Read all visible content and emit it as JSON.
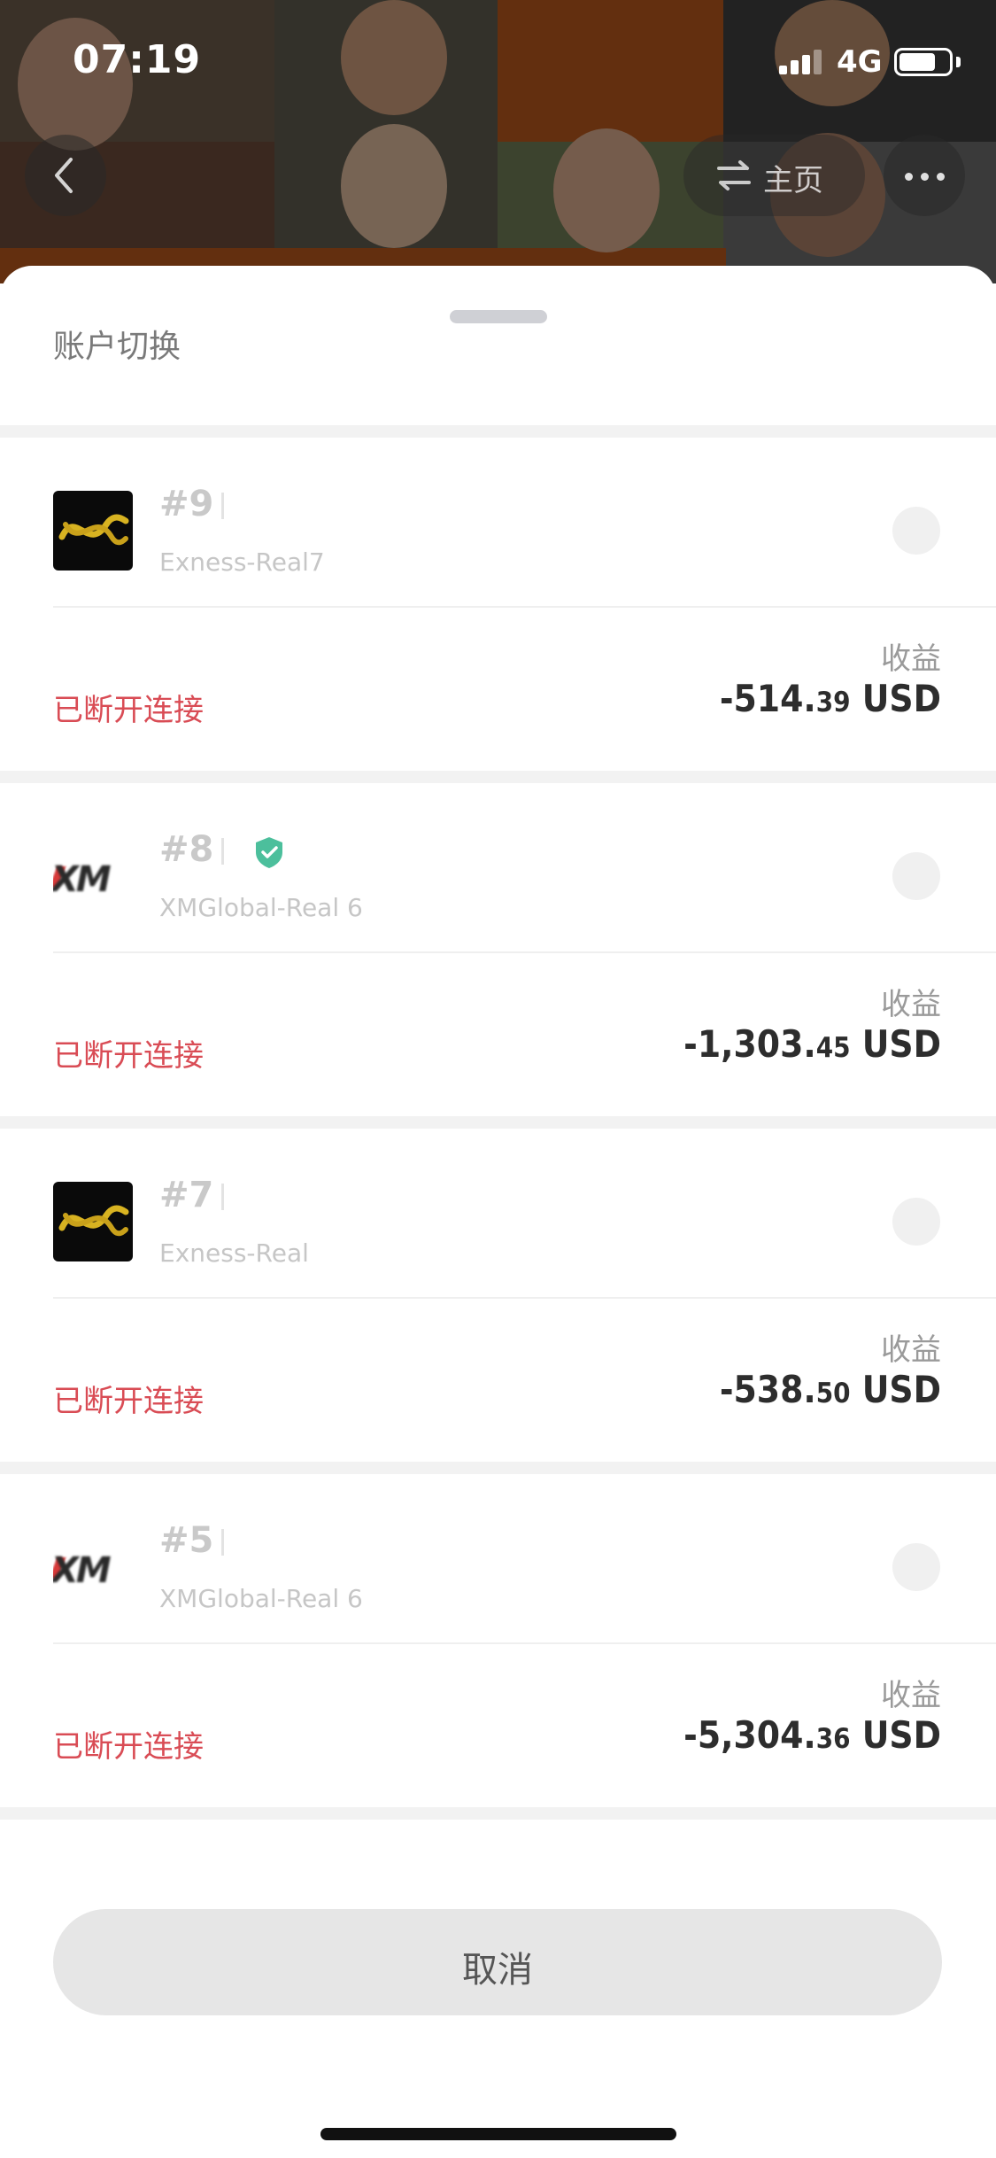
{
  "status_bar": {
    "time": "07:19",
    "network": "4G"
  },
  "nav": {
    "home_label": "主页"
  },
  "sheet": {
    "title": "账户切换"
  },
  "accounts": [
    {
      "number": "#9",
      "server": "Exness-Real7",
      "broker": "exness",
      "verified": false,
      "status": "已断开连接",
      "profit_label": "收益",
      "profit_main": "-514.",
      "profit_decimal": "39",
      "currency": "USD"
    },
    {
      "number": "#8",
      "server": "XMGlobal-Real 6",
      "broker": "xm",
      "verified": true,
      "status": "已断开连接",
      "profit_label": "收益",
      "profit_main": "-1,303.",
      "profit_decimal": "45",
      "currency": "USD"
    },
    {
      "number": "#7",
      "server": "Exness-Real",
      "broker": "exness",
      "verified": false,
      "status": "已断开连接",
      "profit_label": "收益",
      "profit_main": "-538.",
      "profit_decimal": "50",
      "currency": "USD"
    },
    {
      "number": "#5",
      "server": "XMGlobal-Real 6",
      "broker": "xm",
      "verified": false,
      "status": "已断开连接",
      "profit_label": "收益",
      "profit_main": "-5,304.",
      "profit_decimal": "36",
      "currency": "USD"
    }
  ],
  "cancel_label": "取消",
  "colors": {
    "disconnected": "#d94c55",
    "verified": "#4cbf9c",
    "exness_gold": "#d8b321"
  }
}
